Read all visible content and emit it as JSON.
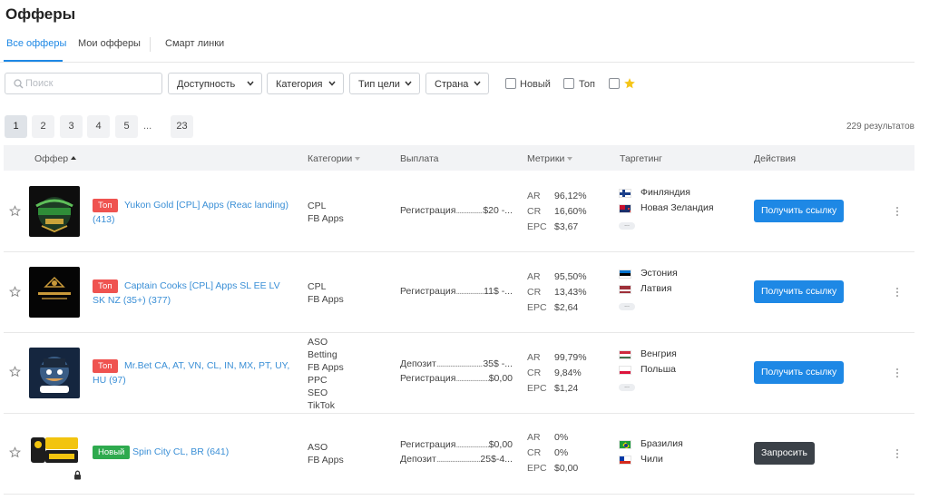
{
  "title": "Офферы",
  "tabs": [
    {
      "label": "Все офферы",
      "active": true
    },
    {
      "label": "Мои офферы",
      "active": false
    },
    {
      "label": "Смарт линки",
      "active": false
    }
  ],
  "filters": {
    "search_placeholder": "Поиск",
    "dropdowns": [
      "Доступность",
      "Категория",
      "Тип цели",
      "Страна"
    ],
    "checkboxes": [
      {
        "label": "Новый",
        "checked": false
      },
      {
        "label": "Топ",
        "checked": false
      },
      {
        "label": "",
        "icon": "star-icon",
        "checked": false
      }
    ]
  },
  "pagination": {
    "pages": [
      "1",
      "2",
      "3",
      "4",
      "5"
    ],
    "current": "1",
    "ellipsis": "...",
    "last": "23",
    "results": "229 результатов"
  },
  "table": {
    "headers": {
      "offer": "Оффер",
      "categories": "Категории",
      "payout": "Выплата",
      "metrics": "Метрики",
      "targeting": "Таргетинг",
      "actions": "Действия"
    },
    "rows": [
      {
        "logo": "yukon-gold-logo",
        "badge": "Топ",
        "badge_type": "top",
        "name": "Yukon Gold [CPL] Apps (Reac landing) (413)",
        "categories": [
          "CPL",
          "FB Apps"
        ],
        "payouts": [
          {
            "label": "Регистрация",
            "value": "$20 -..."
          }
        ],
        "metrics": {
          "AR": "96,12%",
          "CR": "16,60%",
          "EPC": "$3,67"
        },
        "countries": [
          {
            "name": "Финляндия",
            "flag": "fi"
          },
          {
            "name": "Новая Зеландия",
            "flag": "nz"
          }
        ],
        "more": "...",
        "action": "Получить ссылку",
        "action_type": "blue"
      },
      {
        "logo": "captain-cooks-logo",
        "badge": "Топ",
        "badge_type": "top",
        "name": "Captain Cooks [CPL] Apps SL EE LV SK NZ (35+) (377)",
        "categories": [
          "CPL",
          "FB Apps"
        ],
        "payouts": [
          {
            "label": "Регистрация",
            "value": "11$ -..."
          }
        ],
        "metrics": {
          "AR": "95,50%",
          "CR": "13,43%",
          "EPC": "$2,64"
        },
        "countries": [
          {
            "name": "Эстония",
            "flag": "ee"
          },
          {
            "name": "Латвия",
            "flag": "lv"
          }
        ],
        "more": "...",
        "action": "Получить ссылку",
        "action_type": "blue"
      },
      {
        "logo": "mr-bet-logo",
        "badge": "Топ",
        "badge_type": "top",
        "name": "Mr.Bet CA, AT, VN, CL, IN, MX, PT, UY, HU (97)",
        "categories": [
          "ASO",
          "Betting",
          "FB Apps",
          "PPC",
          "SEO",
          "TikTok"
        ],
        "payouts": [
          {
            "label": "Депозит",
            "value": "35$ -..."
          },
          {
            "label": "Регистрация",
            "value": "$0,00"
          }
        ],
        "metrics": {
          "AR": "99,79%",
          "CR": "9,84%",
          "EPC": "$1,24"
        },
        "countries": [
          {
            "name": "Венгрия",
            "flag": "hu"
          },
          {
            "name": "Польша",
            "flag": "pl"
          }
        ],
        "more": "...",
        "action": "Получить ссылку",
        "action_type": "blue"
      },
      {
        "logo": "spin-city-logo",
        "badge": "Новый",
        "badge_type": "new",
        "name": "Spin City CL, BR (641)",
        "categories": [
          "ASO",
          "FB Apps"
        ],
        "payouts": [
          {
            "label": "Регистрация",
            "value": "$0,00"
          },
          {
            "label": "Депозит",
            "value": "25$-4..."
          }
        ],
        "metrics": {
          "AR": "0%",
          "CR": "0%",
          "EPC": "$0,00"
        },
        "countries": [
          {
            "name": "Бразилия",
            "flag": "br"
          },
          {
            "name": "Чили",
            "flag": "cl"
          }
        ],
        "more": "",
        "action": "Запросить",
        "action_type": "dark",
        "locked": true
      }
    ]
  },
  "colors": {
    "accent": "#1e88e5",
    "top_badge": "#ef5350",
    "new_badge": "#2eaa4e",
    "dark_button": "#3b4148",
    "link": "#3a8fd6"
  }
}
